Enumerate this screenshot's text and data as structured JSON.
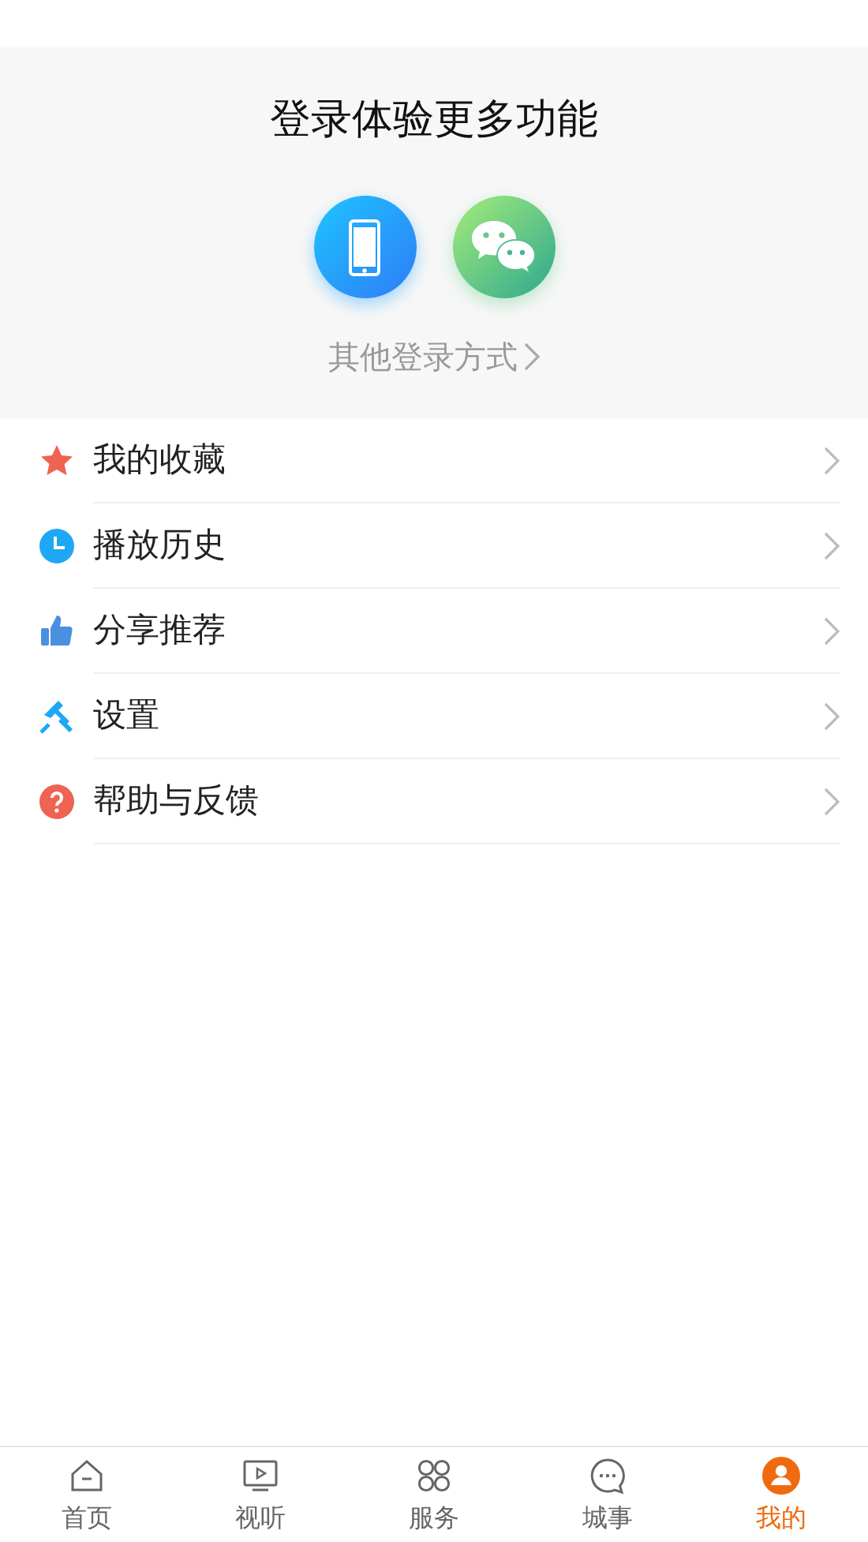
{
  "login": {
    "title": "登录体验更多功能",
    "other_methods": "其他登录方式"
  },
  "menu": [
    {
      "label": "我的收藏"
    },
    {
      "label": "播放历史"
    },
    {
      "label": "分享推荐"
    },
    {
      "label": "设置"
    },
    {
      "label": "帮助与反馈"
    }
  ],
  "tabs": [
    {
      "label": "首页",
      "selected": false
    },
    {
      "label": "视听",
      "selected": false
    },
    {
      "label": "服务",
      "selected": false
    },
    {
      "label": "城事",
      "selected": false
    },
    {
      "label": "我的",
      "selected": true
    }
  ]
}
